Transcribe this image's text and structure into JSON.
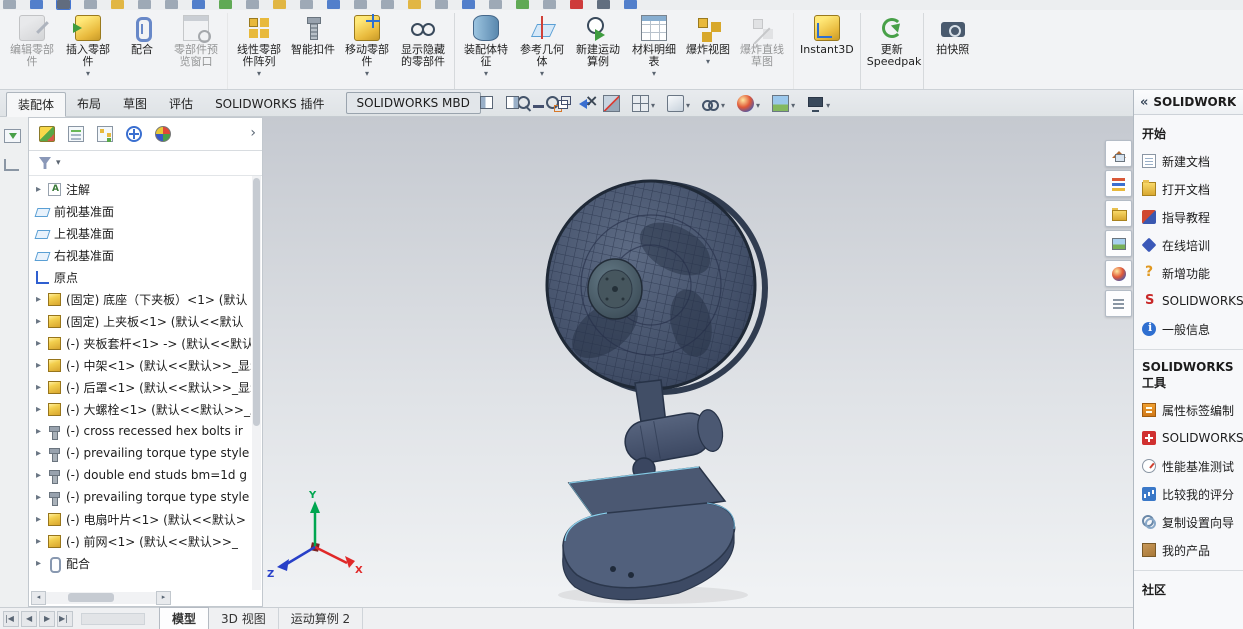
{
  "colors": {
    "viewport_top": "#c5c9d0",
    "viewport_bottom": "#f1f3f5",
    "model_body": "#4e5b74",
    "model_edge": "#2b374c",
    "highlight_edge": "#8fd8f4",
    "triad_x": "#e02828",
    "triad_y": "#00a650",
    "triad_z": "#2840c8"
  },
  "titlestrip": {
    "stubs": [
      {
        "cls": "tc-gray"
      },
      {
        "cls": "tc-blue"
      },
      {
        "cls": "tc-dark pressed"
      },
      {
        "cls": "tc-gray"
      },
      {
        "cls": "tc-yellow"
      },
      {
        "cls": "tc-gray"
      },
      {
        "cls": "tc-gray"
      },
      {
        "cls": "tc-blue"
      },
      {
        "cls": "tc-green"
      },
      {
        "cls": "tc-gray"
      },
      {
        "cls": "tc-yellow"
      },
      {
        "cls": "tc-gray"
      },
      {
        "cls": "tc-blue"
      },
      {
        "cls": "tc-gray"
      },
      {
        "cls": "tc-gray"
      },
      {
        "cls": "tc-yellow"
      },
      {
        "cls": "tc-gray"
      },
      {
        "cls": "tc-blue"
      },
      {
        "cls": "tc-gray"
      },
      {
        "cls": "tc-green"
      },
      {
        "cls": "tc-gray"
      },
      {
        "cls": "tc-red"
      },
      {
        "cls": "tc-dark"
      },
      {
        "cls": "tc-blue"
      }
    ]
  },
  "ribbon": {
    "buttons": [
      {
        "label": "编辑零部件",
        "icon": "edit-component",
        "cls": "disabled"
      },
      {
        "label": "插入零部件",
        "icon": "insert-component",
        "dd": true
      },
      {
        "label": "配合",
        "icon": "mate"
      },
      {
        "label": "零部件预览窗口",
        "icon": "preview-window",
        "cls": "disabled sep"
      },
      {
        "label": "线性零部件阵列",
        "icon": "linear-pattern",
        "dd": true
      },
      {
        "label": "智能扣件",
        "icon": "smart-fasteners"
      },
      {
        "label": "移动零部件",
        "icon": "move-component",
        "dd": true
      },
      {
        "label": "显示隐藏的零部件",
        "icon": "show-hidden",
        "cls": "sep"
      },
      {
        "label": "装配体特征",
        "icon": "assembly-features",
        "dd": true
      },
      {
        "label": "参考几何体",
        "icon": "reference-geometry",
        "dd": true
      },
      {
        "label": "新建运动算例",
        "icon": "motion-study"
      },
      {
        "label": "材料明细表",
        "icon": "bom",
        "dd": true
      },
      {
        "label": "爆炸视图",
        "icon": "exploded-view",
        "dd": true
      },
      {
        "label": "爆炸直线草图",
        "icon": "explode-sketch",
        "cls": "disabled sep"
      },
      {
        "label": "Instant3D",
        "icon": "instant3d",
        "cls": "nowrap sep"
      },
      {
        "label": "更新Speedpak",
        "icon": "speedpak",
        "cls": "sep"
      },
      {
        "label": "拍快照",
        "icon": "snapshot"
      }
    ]
  },
  "tabs": {
    "items": [
      {
        "label": "装配体",
        "cls": "active"
      },
      {
        "label": "布局"
      },
      {
        "label": "草图"
      },
      {
        "label": "评估"
      },
      {
        "label": "SOLIDWORKS 插件"
      }
    ],
    "mbd_label": "SOLIDWORKS MBD"
  },
  "viewbar": {
    "items": [
      {
        "icon": "zoom-fit"
      },
      {
        "icon": "zoom-area"
      },
      {
        "icon": "previous-view"
      },
      {
        "icon": "section-view"
      },
      {
        "icon": "view-orientation",
        "dd": true
      },
      {
        "icon": "display-style",
        "dd": true
      },
      {
        "icon": "hide-show",
        "dd": true
      },
      {
        "icon": "edit-appearance",
        "dd": true
      },
      {
        "icon": "apply-scene",
        "dd": true
      },
      {
        "icon": "view-settings",
        "dd": true
      }
    ]
  },
  "window_controls": {
    "items": [
      {
        "icon": "tile-left"
      },
      {
        "icon": "tile-right"
      },
      {
        "icon": "minimize"
      },
      {
        "icon": "restore"
      },
      {
        "icon": "close"
      }
    ]
  },
  "gutter": {
    "icons": [
      {
        "icon": "flyout"
      },
      {
        "icon": "corner"
      }
    ]
  },
  "feature_tree": {
    "tabs": [
      {
        "icon": "feature-manager"
      },
      {
        "icon": "property-manager"
      },
      {
        "icon": "configuration-manager"
      },
      {
        "icon": "dimxpert"
      },
      {
        "icon": "display-manager"
      }
    ],
    "expand_label": "›",
    "items": [
      {
        "arrow": true,
        "icon": "annotations",
        "label": "注解"
      },
      {
        "icon": "plane",
        "label": "前视基准面"
      },
      {
        "icon": "plane",
        "label": "上视基准面"
      },
      {
        "icon": "plane",
        "label": "右视基准面"
      },
      {
        "icon": "origin",
        "label": "原点"
      },
      {
        "arrow": true,
        "icon": "part",
        "label": "(固定) 底座（下夹板）<1> (默认"
      },
      {
        "arrow": true,
        "icon": "part",
        "label": "(固定) 上夹板<1> (默认<<默认"
      },
      {
        "arrow": true,
        "icon": "part",
        "label": "(-) 夹板套杆<1> -> (默认<<默认"
      },
      {
        "arrow": true,
        "icon": "part",
        "label": "(-) 中架<1> (默认<<默认>>_显示"
      },
      {
        "arrow": true,
        "icon": "part",
        "label": "(-) 后罩<1> (默认<<默认>>_显示"
      },
      {
        "arrow": true,
        "icon": "part",
        "label": "(-) 大螺栓<1> (默认<<默认>>_显"
      },
      {
        "arrow": true,
        "icon": "bolt",
        "label": "(-) cross recessed hex bolts ir"
      },
      {
        "arrow": true,
        "icon": "bolt",
        "label": "(-) prevailing torque type style"
      },
      {
        "arrow": true,
        "icon": "bolt",
        "label": "(-) double end studs bm=1d g"
      },
      {
        "arrow": true,
        "icon": "bolt",
        "label": "(-) prevailing torque type style"
      },
      {
        "arrow": true,
        "icon": "part",
        "label": "(-) 电扇叶片<1> (默认<<默认>"
      },
      {
        "arrow": true,
        "icon": "part",
        "label": "(-) 前网<1> (默认<<默认>>_"
      },
      {
        "arrow": true,
        "icon": "mates",
        "label": "配合"
      }
    ]
  },
  "viewport": {
    "triad": {
      "x": "X",
      "y": "Y",
      "z": "Z"
    }
  },
  "taskpane": {
    "collapse_label": "«",
    "title": "SOLIDWORK",
    "tabs": [
      {
        "icon": "home"
      },
      {
        "icon": "design-library"
      },
      {
        "icon": "file-explorer"
      },
      {
        "icon": "view-palette"
      },
      {
        "icon": "appearances"
      },
      {
        "icon": "custom-properties"
      }
    ],
    "start_title": "开始",
    "start_items": [
      {
        "icon": "new-doc",
        "label": "新建文档"
      },
      {
        "icon": "open-doc",
        "label": "打开文档"
      },
      {
        "icon": "tutorials",
        "label": "指导教程"
      },
      {
        "icon": "online-training",
        "label": "在线培训"
      },
      {
        "icon": "whats-new",
        "label": "新增功能"
      },
      {
        "icon": "sw-forum",
        "label": "SOLIDWORKS"
      },
      {
        "icon": "general-info",
        "label": "一般信息"
      }
    ],
    "tools_title": "SOLIDWORKS 工具",
    "tools_items": [
      {
        "icon": "property-tab-builder",
        "label": "属性标签编制"
      },
      {
        "icon": "sw-rx",
        "label": "SOLIDWORKS"
      },
      {
        "icon": "benchmark",
        "label": "性能基准测试"
      },
      {
        "icon": "compare-scores",
        "label": "比较我的评分"
      },
      {
        "icon": "copy-settings",
        "label": "复制设置向导"
      },
      {
        "icon": "my-products",
        "label": "我的产品"
      }
    ],
    "community_title": "社区"
  },
  "statusbar": {
    "nav": [
      {
        "icon": "first"
      },
      {
        "icon": "prev"
      },
      {
        "icon": "next"
      },
      {
        "icon": "last"
      }
    ],
    "tabs": [
      {
        "label": "模型",
        "cls": "active"
      },
      {
        "label": "3D 视图"
      },
      {
        "label": "运动算例 2"
      }
    ]
  }
}
